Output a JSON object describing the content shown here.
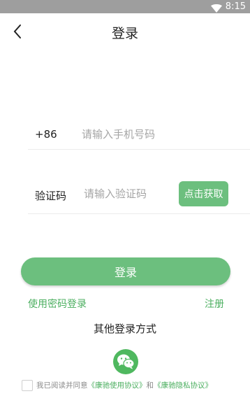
{
  "status_bar": {
    "time": "8:15",
    "wifi_icon": "wifi-icon"
  },
  "header": {
    "title": "登录",
    "back_icon": "chevron-left-icon"
  },
  "phone": {
    "prefix": "+86",
    "placeholder": "请输入手机号码",
    "value": ""
  },
  "code": {
    "label": "验证码",
    "placeholder": "请输入验证码",
    "value": "",
    "button": "点击获取"
  },
  "login_button": "登录",
  "links": {
    "password_login": "使用密码登录",
    "register": "注册"
  },
  "other_login": {
    "title": "其他登录方式",
    "wechat_icon": "wechat-icon"
  },
  "agreement": {
    "checked": false,
    "text_prefix": "我已阅读并同意",
    "terms": "《康驰使用协议》",
    "and": "和",
    "privacy": "《康驰隐私协议》"
  },
  "colors": {
    "accent": "#6cbf7e",
    "link": "#4caf60",
    "status_bar": "#9e9e9e"
  }
}
